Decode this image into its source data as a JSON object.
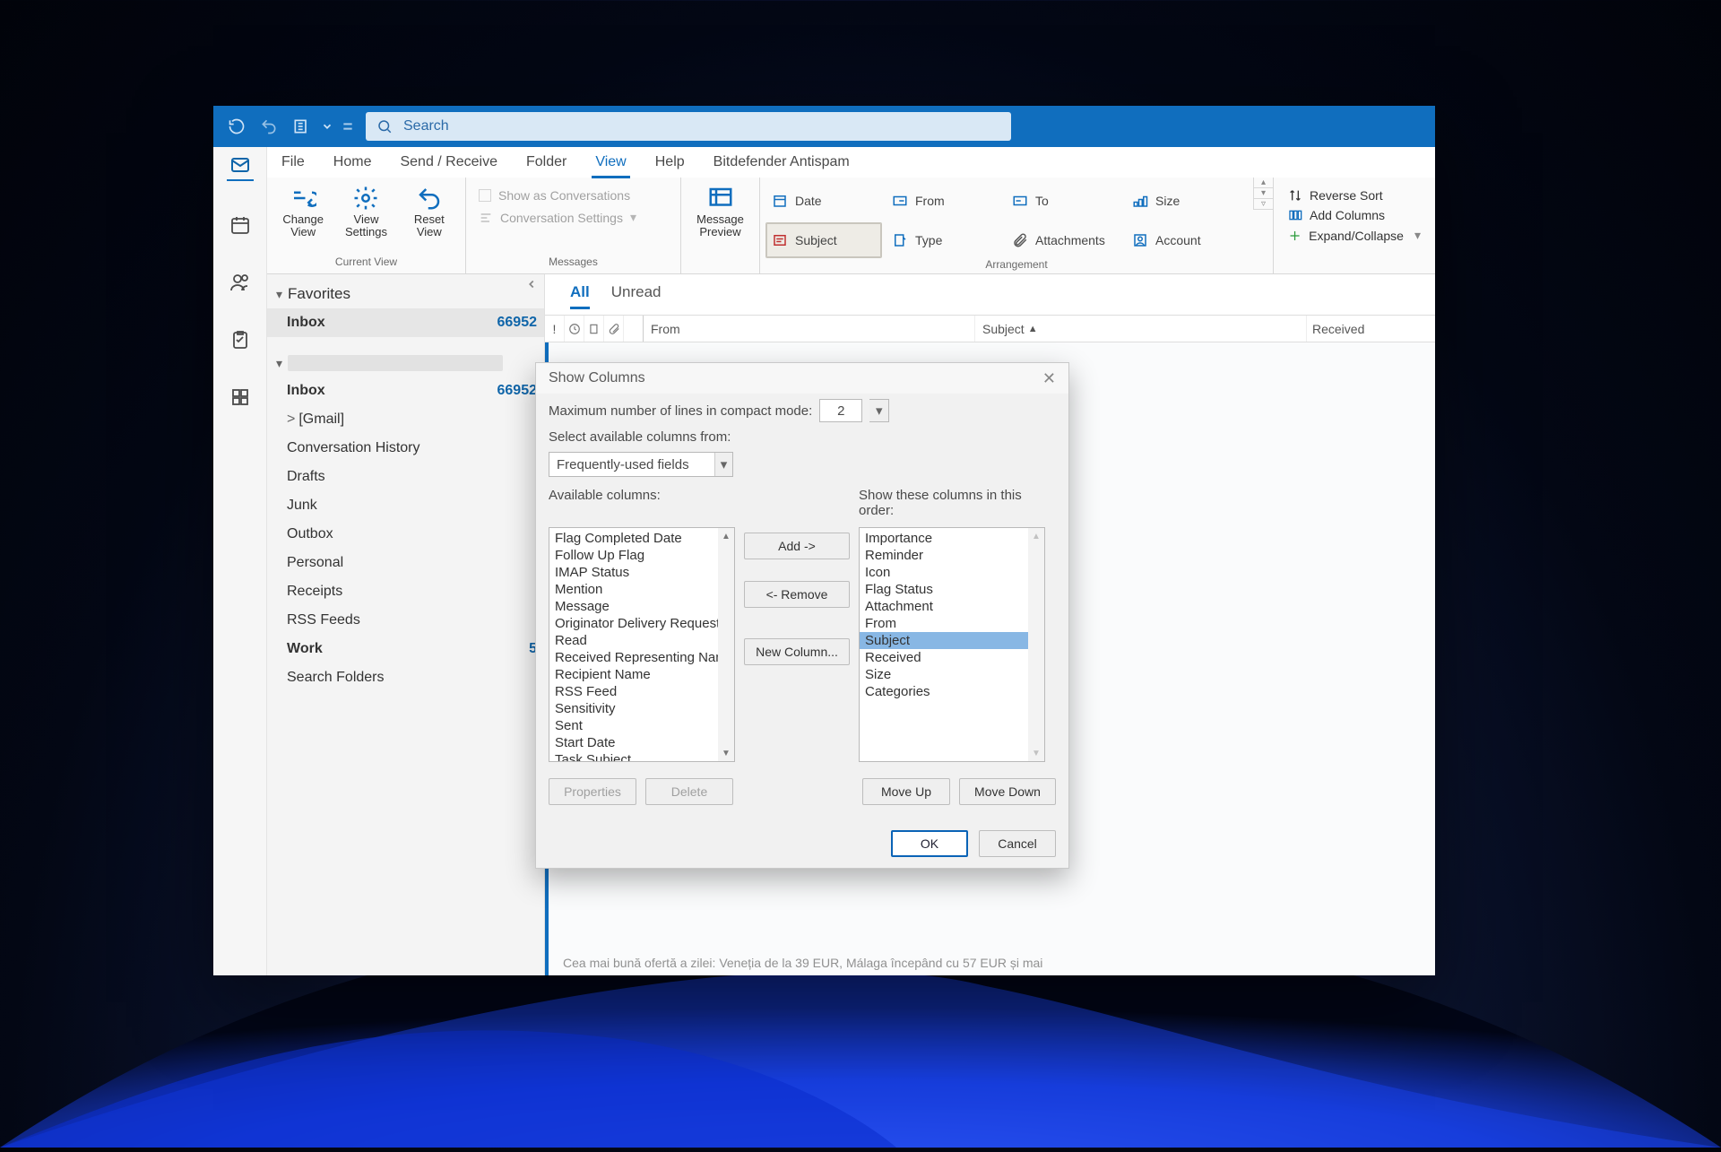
{
  "search": {
    "placeholder": "Search"
  },
  "menus": {
    "file": "File",
    "home": "Home",
    "sendrecv": "Send / Receive",
    "folder": "Folder",
    "view": "View",
    "help": "Help",
    "bitdef": "Bitdefender Antispam"
  },
  "ribbon": {
    "currentView": {
      "change": "Change\nView",
      "settings": "View\nSettings",
      "reset": "Reset\nView",
      "label": "Current View"
    },
    "messages": {
      "showConv": "Show as Conversations",
      "convSet": "Conversation Settings",
      "preview": "Message\nPreview",
      "label": "Messages"
    },
    "arrangement": {
      "date": "Date",
      "from": "From",
      "to": "To",
      "size": "Size",
      "subject": "Subject",
      "type": "Type",
      "attachments": "Attachments",
      "account": "Account",
      "label": "Arrangement"
    },
    "right": {
      "reverse": "Reverse Sort",
      "addcol": "Add Columns",
      "expand": "Expand/Collapse"
    }
  },
  "folders": {
    "favorites": "Favorites",
    "inbox": "Inbox",
    "inboxCount": "66952",
    "items": [
      {
        "label": "Inbox",
        "count": "66952"
      },
      {
        "label": "[Gmail]",
        "chev": ">"
      },
      {
        "label": "Conversation History"
      },
      {
        "label": "Drafts"
      },
      {
        "label": "Junk"
      },
      {
        "label": "Outbox"
      },
      {
        "label": "Personal"
      },
      {
        "label": "Receipts"
      },
      {
        "label": "RSS Feeds"
      },
      {
        "label": "Work",
        "count": "5"
      },
      {
        "label": "Search Folders"
      }
    ]
  },
  "list": {
    "tabs": {
      "all": "All",
      "unread": "Unread"
    },
    "head": {
      "from": "From",
      "subject": "Subject",
      "received": "Received"
    },
    "truncated": "Cea mai bună ofertă a zilei: Veneția de la 39 EUR, Málaga începând cu 57 EUR și mai"
  },
  "dialog": {
    "title": "Show Columns",
    "maxLinesLabel": "Maximum number of lines in compact mode:",
    "maxLines": "2",
    "selectFromLabel": "Select available columns from:",
    "selectFromValue": "Frequently-used fields",
    "availLabel": "Available columns:",
    "orderLabel": "Show these columns in this order:",
    "available": [
      "Flag Completed Date",
      "Follow Up Flag",
      "IMAP Status",
      "Mention",
      "Message",
      "Originator Delivery Request",
      "Read",
      "Received Representing Name",
      "Recipient Name",
      "RSS Feed",
      "Sensitivity",
      "Sent",
      "Start Date",
      "Task Subject"
    ],
    "order": [
      "Importance",
      "Reminder",
      "Icon",
      "Flag Status",
      "Attachment",
      "From",
      "Subject",
      "Received",
      "Size",
      "Categories"
    ],
    "orderSelected": "Subject",
    "buttons": {
      "add": "Add ->",
      "remove": "<- Remove",
      "newcol": "New Column...",
      "properties": "Properties",
      "delete": "Delete",
      "moveup": "Move Up",
      "movedown": "Move Down",
      "ok": "OK",
      "cancel": "Cancel"
    }
  }
}
